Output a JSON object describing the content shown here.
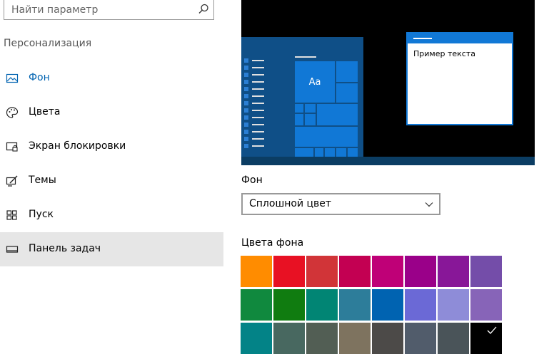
{
  "search": {
    "placeholder": "Найти параметр",
    "icon": "search-icon"
  },
  "sidebar": {
    "section_title": "Персонализация",
    "items": [
      {
        "label": "Фон",
        "icon": "picture-icon",
        "active": true
      },
      {
        "label": "Цвета",
        "icon": "palette-icon"
      },
      {
        "label": "Экран блокировки",
        "icon": "lock-screen-icon"
      },
      {
        "label": "Темы",
        "icon": "brush-icon"
      },
      {
        "label": "Пуск",
        "icon": "start-grid-icon"
      },
      {
        "label": "Панель задач",
        "icon": "taskbar-icon",
        "selected": true
      }
    ]
  },
  "preview": {
    "tile_label": "Aa",
    "window_text": "Пример текста"
  },
  "background": {
    "label": "Фон",
    "selected": "Сплошной цвет"
  },
  "colors": {
    "label": "Цвета фона",
    "swatches": [
      "#ff8c00",
      "#e81123",
      "#d13438",
      "#c30052",
      "#bf0077",
      "#9a0089",
      "#881798",
      "#744da9",
      "#10893e",
      "#107c10",
      "#018574",
      "#2d7d9a",
      "#0063b1",
      "#6b69d6",
      "#8e8cd8",
      "#8764b8",
      "#038387",
      "#486860",
      "#525e54",
      "#7e735f",
      "#4c4a48",
      "#515c6b",
      "#4a5459",
      "#000000"
    ],
    "selected_index": 23
  },
  "accent_color": "#0063b1"
}
